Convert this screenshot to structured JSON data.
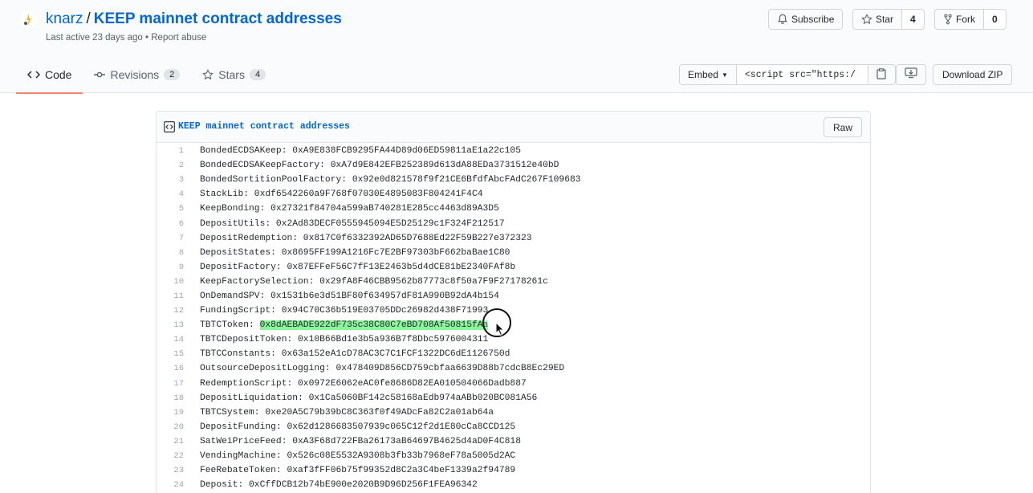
{
  "header": {
    "owner": "knarz",
    "separator": "/",
    "gist_name": "KEEP mainnet contract addresses",
    "meta": "Last active 23 days ago • Report abuse",
    "subscribe_label": "Subscribe",
    "star_label": "Star",
    "star_count": "4",
    "fork_label": "Fork",
    "fork_count": "0"
  },
  "tabs": [
    {
      "label": "Code",
      "icon": "code-icon",
      "active": true
    },
    {
      "label": "Revisions",
      "icon": "commit-icon",
      "count": "2"
    },
    {
      "label": "Stars",
      "icon": "star-icon",
      "count": "4"
    }
  ],
  "toolbar": {
    "embed_label": "Embed",
    "embed_value": "<script src=\"https:/",
    "download_label": "Download ZIP"
  },
  "file": {
    "name": "KEEP mainnet contract addresses",
    "raw_label": "Raw",
    "highlighted_line": 13,
    "highlighted_text": "0x8dAEBADE922dF735c38C80C7eBD708Af50815fAa",
    "lines": [
      "BondedECDSAKeep: 0xA9E838FCB9295FA44D89d06ED59811aE1a22c105",
      "BondedECDSAKeepFactory: 0xA7d9E842EFB252389d613dA88EDa3731512e40bD",
      "BondedSortitionPoolFactory: 0x92e0d821578f9f21CE6BfdfAbcFAdC267F109683",
      "StackLib: 0xdf6542260a9F768f07030E4895083F804241F4C4",
      "KeepBonding: 0x27321f84704a599aB740281E285cc4463d89A3D5",
      "DepositUtils: 0x2Ad83DECF0555945094E5D25129c1F324F212517",
      "DepositRedemption: 0x817C0f6332392AD65D7688Ed22F59B227e372323",
      "DepositStates: 0x8695FF199A1216Fc7E2BF97303bF662baBae1C80",
      "DepositFactory: 0x87EFFeF56C7fF13E2463b5d4dCE81bE2340FAf8b",
      "KeepFactorySelection: 0x29fA8F46CBB9562b87773c8f50a7F9F27178261c",
      "OnDemandSPV: 0x1531b6e3d51BF80f634957dF81A990B92dA4b154",
      "FundingScript: 0x94C70C36b519E03705DDc26982d438F71993",
      "TBTCToken: 0x8dAEBADE922dF735c38C80C7eBD708Af50815fAa",
      "TBTCDepositToken: 0x10B66Bd1e3b5a936B7f8Dbc5976004311",
      "TBTCConstants: 0x63a152eA1cD78AC3C7C1FCF1322DC6dE1126750d",
      "OutsourceDepositLogging: 0x478409D856CD759cbfaa6639D88b7cdcB8Ec29ED",
      "RedemptionScript: 0x0972E6062eAC0fe8686D82EA010504066Dadb887",
      "DepositLiquidation: 0x1Ca5060BF142c58168aEdb974aABb020BC081A56",
      "TBTCSystem: 0xe20A5C79b39bC8C363f0f49ADcFa82C2a01ab64a",
      "DepositFunding: 0x62d1286683507939c065C12f2d1E80cCa8CCD125",
      "SatWeiPriceFeed: 0xA3F68d722FBa26173aB64697B4625d4aD0F4C818",
      "VendingMachine: 0x526c08E5532A9308b3fb33b7968eF78a5005d2AC",
      "FeeRebateToken: 0xaf3fFF06b75f99352d8C2a3C4beF1339a2f94789",
      "Deposit: 0xCffDCB12b74bE900e2020B9D96D256F1FEA96342"
    ]
  }
}
